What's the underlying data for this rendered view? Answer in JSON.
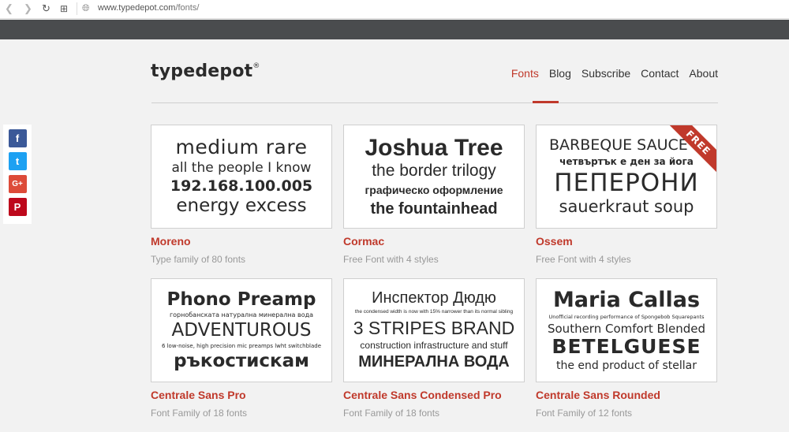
{
  "browser": {
    "url_host": "www.typedepot.com",
    "url_path": "/fonts/"
  },
  "header": {
    "logo": "typedepot",
    "logo_mark": "®",
    "nav": [
      "Fonts",
      "Blog",
      "Subscribe",
      "Contact",
      "About"
    ],
    "active_nav": "Fonts"
  },
  "social": {
    "icons": [
      "facebook-icon",
      "twitter-icon",
      "google-plus-icon",
      "pinterest-icon"
    ],
    "glyphs": [
      "f",
      "t",
      "G+",
      "P"
    ]
  },
  "fonts": [
    {
      "name": "Moreno",
      "subtitle": "Type family of 80 fonts",
      "preview": [
        "medium rare",
        "all the people I know",
        "192.168.100.005",
        "energy excess"
      ]
    },
    {
      "name": "Cormac",
      "subtitle": "Free Font with 4 styles",
      "preview": [
        "Joshua Tree",
        "the border trilogy",
        "графическо оформление",
        "the fountainhead"
      ]
    },
    {
      "name": "Ossem",
      "subtitle": "Free Font with 4 styles",
      "badge": "FREE",
      "preview": [
        "BARBEQUE SAUCE",
        "четвъртък е ден за йога",
        "ПЕПЕРОНИ",
        "sauerkraut soup"
      ]
    },
    {
      "name": "Centrale Sans Pro",
      "subtitle": "Font Family of 18 fonts",
      "preview": [
        "Phono Preamp",
        "горнобанската натурална минерална вода",
        "ADVENTUROUS",
        "6 low-noise, high precision mic preamps lwht switchblade",
        "ръкостискам"
      ]
    },
    {
      "name": "Centrale Sans Condensed Pro",
      "subtitle": "Font Family of 18 fonts",
      "preview": [
        "Инспектор Дюдю",
        "the condensed width is now with 15% narrower than its normal sibling",
        "3 STRIPES BRAND",
        "construction infrastructure and stuff",
        "МИНЕРАЛНА ВОДА"
      ]
    },
    {
      "name": "Centrale Sans Rounded",
      "subtitle": "Font Family of 12 fonts",
      "preview": [
        "Maria Callas",
        "Unofficial recording performance of Spongebob Squarepants",
        "Southern Comfort Blended",
        "BETELGUESE",
        "the end product of stellar"
      ]
    }
  ],
  "colors": {
    "accent": "#c0392b",
    "dark_bar": "#4a4c4e",
    "background": "#f2f2f2"
  }
}
